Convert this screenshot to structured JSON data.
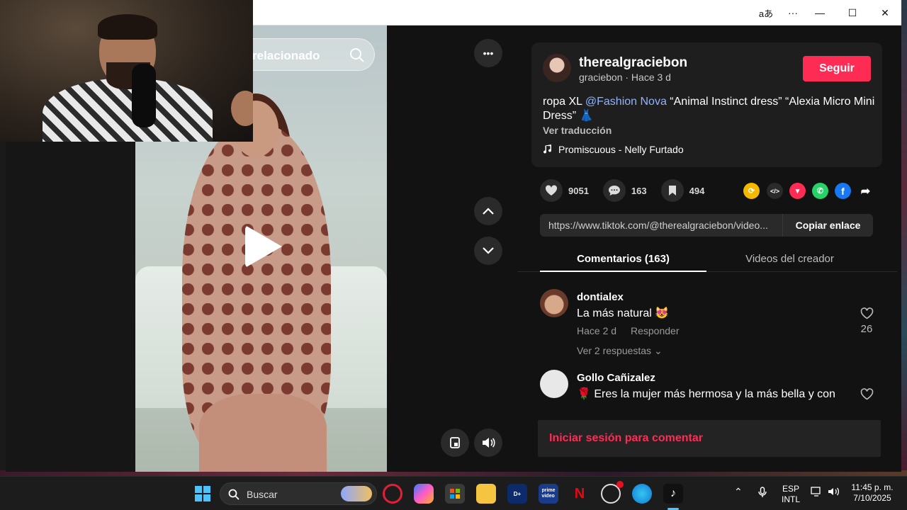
{
  "window": {
    "titlebar_icons": [
      "read-aloud-icon",
      "more-icon",
      "minimize-icon",
      "maximize-icon",
      "close-icon"
    ],
    "titlebar_labels": {
      "read_aloud": "aあ",
      "more": "···",
      "minimize": "—",
      "maximize": "☐",
      "close": "✕"
    }
  },
  "video": {
    "search_text": "relacionado",
    "controls": {
      "more": "•••"
    }
  },
  "author": {
    "username": "therealgraciebon",
    "subline": "graciebon · Hace 3 d",
    "follow_label": "Seguir"
  },
  "post": {
    "desc_prefix": "ropa XL ",
    "mention": "@Fashion Nova",
    "desc_suffix": " “Animal Instinct dress” “Alexia Micro Mini Dress” 👗",
    "translate_label": "Ver traducción",
    "music": "Promiscuous - Nelly Furtado"
  },
  "stats": {
    "likes": "9051",
    "comments": "163",
    "saves": "494"
  },
  "link": {
    "url": "https://www.tiktok.com/@therealgraciebon/video...",
    "copy_label": "Copiar enlace"
  },
  "tabs": {
    "comments": "Comentarios (163)",
    "creator_videos": "Videos del creador"
  },
  "comments": [
    {
      "name": "dontialex",
      "text": "La más natural 😻",
      "time": "Hace 2 d",
      "reply": "Responder",
      "more": "Ver 2 respuestas ⌄",
      "likes": "26"
    },
    {
      "name": "Gollo Cañizalez",
      "text": "🌹 Eres la mujer más hermosa y la más bella y con"
    }
  ],
  "login_label": "Iniciar sesión para comentar",
  "taskbar": {
    "search_placeholder": "Buscar",
    "lang": "ESP",
    "layout": "INTL",
    "time": "11:45 p. m.",
    "date": "7/10/2025"
  },
  "colors": {
    "accent": "#fe2c55",
    "mention": "#8fb4ff",
    "bg": "#121212"
  }
}
